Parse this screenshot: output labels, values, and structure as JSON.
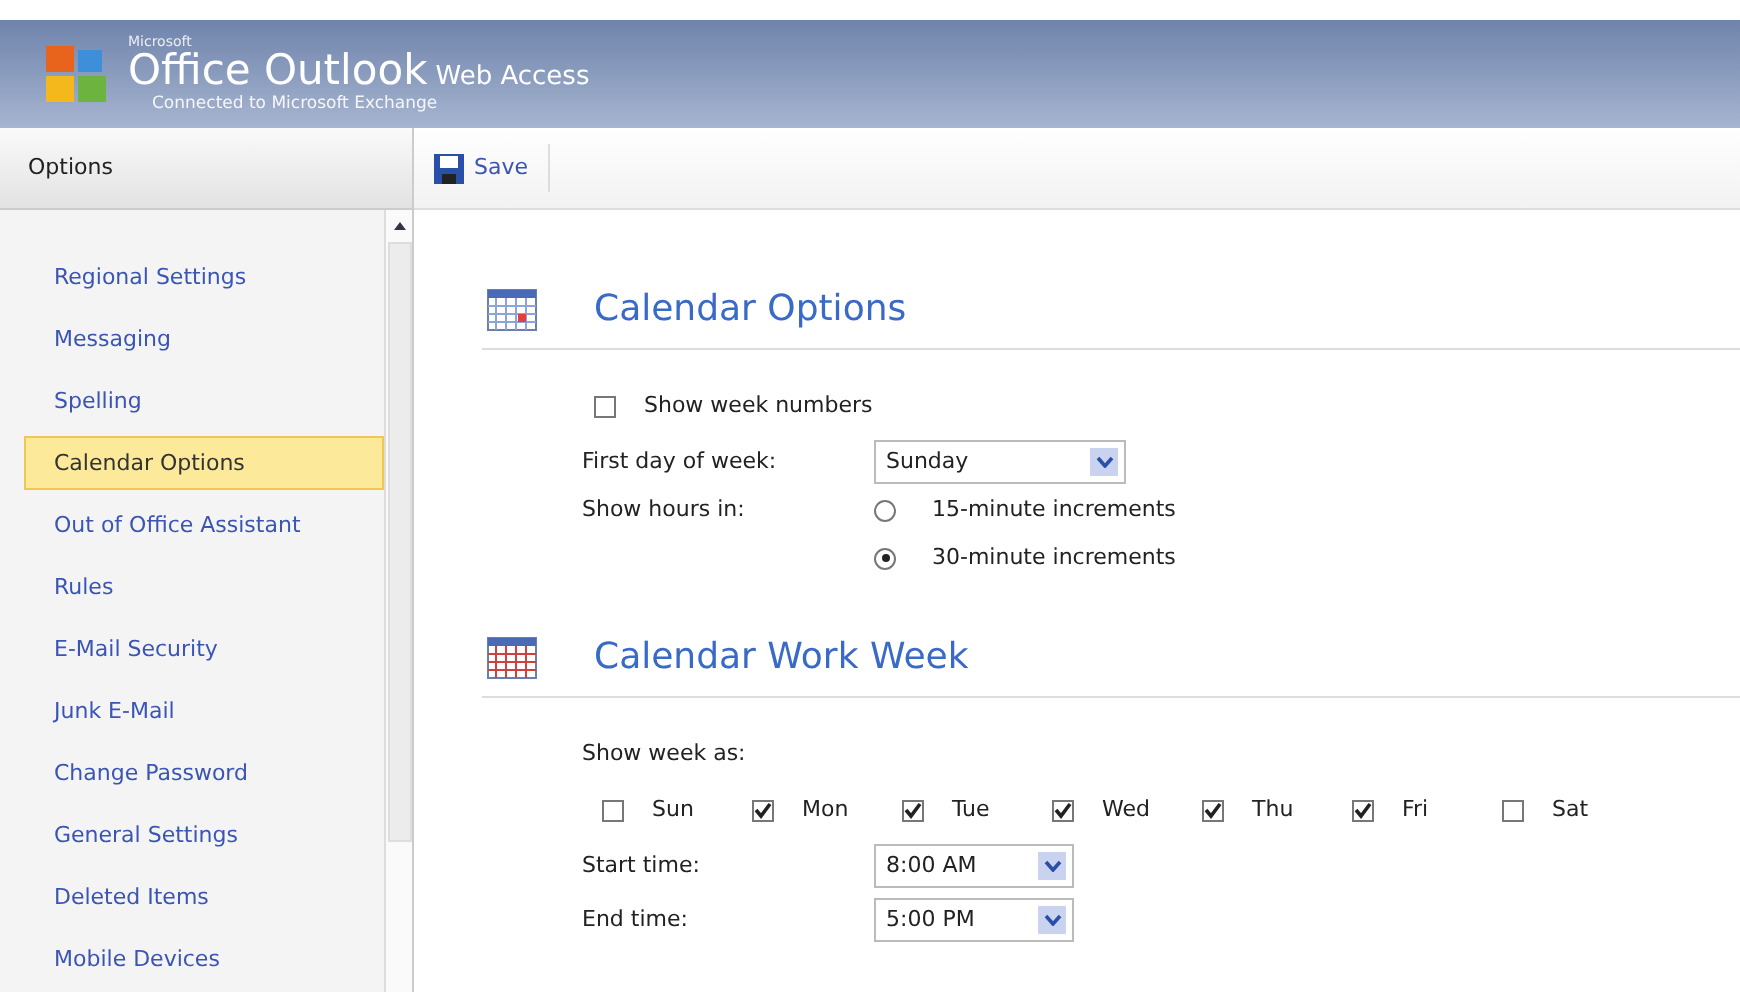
{
  "header": {
    "brand_small": "Microsoft",
    "brand": "Office Outlook",
    "brand_suffix": "Web Access",
    "subtitle": "Connected to Microsoft Exchange"
  },
  "sidebar": {
    "title": "Options",
    "items": [
      {
        "label": "Regional Settings",
        "selected": false
      },
      {
        "label": "Messaging",
        "selected": false
      },
      {
        "label": "Spelling",
        "selected": false
      },
      {
        "label": "Calendar Options",
        "selected": true
      },
      {
        "label": "Out of Office Assistant",
        "selected": false
      },
      {
        "label": "Rules",
        "selected": false
      },
      {
        "label": "E-Mail Security",
        "selected": false
      },
      {
        "label": "Junk E-Mail",
        "selected": false
      },
      {
        "label": "Change Password",
        "selected": false
      },
      {
        "label": "General Settings",
        "selected": false
      },
      {
        "label": "Deleted Items",
        "selected": false
      },
      {
        "label": "Mobile Devices",
        "selected": false
      }
    ]
  },
  "toolbar": {
    "save": "Save"
  },
  "calendar_options": {
    "title": "Calendar Options",
    "show_week_numbers": {
      "label": "Show week numbers",
      "checked": false
    },
    "first_day": {
      "label": "First day of week:",
      "value": "Sunday"
    },
    "show_hours": {
      "label": "Show hours in:",
      "options": [
        {
          "label": "15-minute increments",
          "selected": false
        },
        {
          "label": "30-minute increments",
          "selected": true
        }
      ]
    }
  },
  "work_week": {
    "title": "Calendar Work Week",
    "show_week_as": "Show week as:",
    "days": [
      {
        "label": "Sun",
        "checked": false
      },
      {
        "label": "Mon",
        "checked": true
      },
      {
        "label": "Tue",
        "checked": true
      },
      {
        "label": "Wed",
        "checked": true
      },
      {
        "label": "Thu",
        "checked": true
      },
      {
        "label": "Fri",
        "checked": true
      },
      {
        "label": "Sat",
        "checked": false
      }
    ],
    "start_time": {
      "label": "Start time:",
      "value": "8:00 AM"
    },
    "end_time": {
      "label": "End time:",
      "value": "5:00 PM"
    }
  }
}
